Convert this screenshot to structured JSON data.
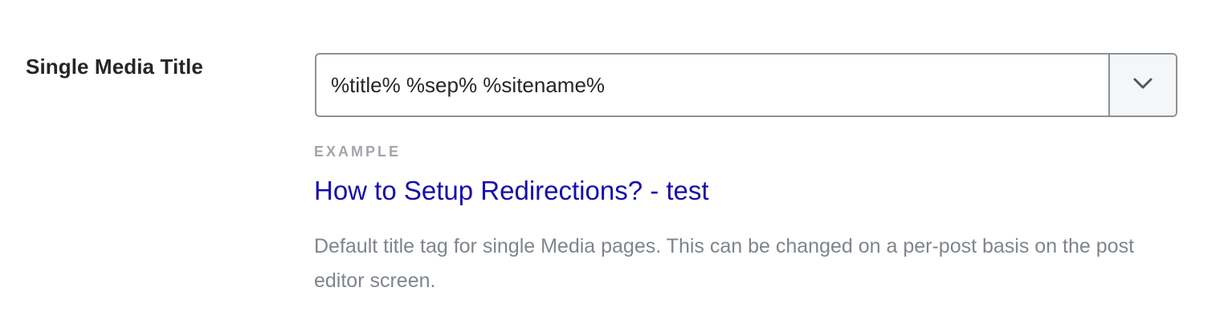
{
  "field": {
    "label": "Single Media Title",
    "value": "%title% %sep% %sitename%",
    "dropdown_icon": "chevron-down-icon"
  },
  "example": {
    "label": "EXAMPLE",
    "title": "How to Setup Redirections? - test",
    "title_color": "#1a0dab"
  },
  "description": "Default title tag for single Media pages. This can be changed on a per-post basis on the post editor screen."
}
